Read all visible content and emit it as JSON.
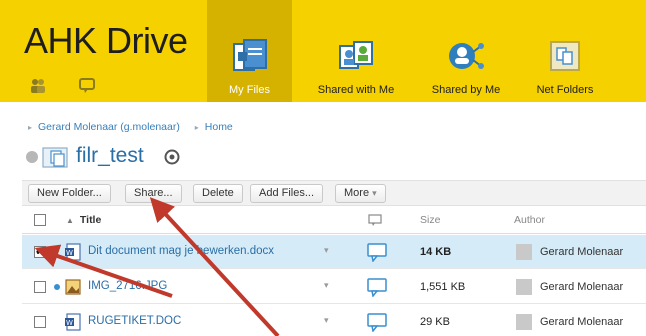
{
  "app": {
    "title": "AHK Drive"
  },
  "colors": {
    "header_bg": "#f6d100",
    "active_tab": "#d6b200",
    "link": "#2a6ea6",
    "selected_row": "#d5ecf8",
    "arrow": "#c0392b"
  },
  "header_icons": [
    {
      "name": "users-icon"
    },
    {
      "name": "chat-icon"
    }
  ],
  "nav": [
    {
      "label": "My Files",
      "icon": "my-files-icon",
      "active": true
    },
    {
      "label": "Shared with Me",
      "icon": "shared-with-me-icon",
      "active": false
    },
    {
      "label": "Shared by Me",
      "icon": "shared-by-me-icon",
      "active": false
    },
    {
      "label": "Net Folders",
      "icon": "net-folders-icon",
      "active": false
    }
  ],
  "breadcrumb": [
    {
      "label": "Gerard Molenaar (g.molenaar)"
    },
    {
      "label": "Home"
    }
  ],
  "folder": {
    "name": "filr_test"
  },
  "toolbar": {
    "new_folder": "New Folder...",
    "share": "Share...",
    "delete": "Delete",
    "add_files": "Add Files...",
    "more": "More"
  },
  "table": {
    "columns": {
      "title": "Title",
      "size": "Size",
      "author": "Author"
    },
    "rows": [
      {
        "name": "Dit document mag je bewerken.docx",
        "size": "14 KB",
        "author": "Gerard Molenaar",
        "checked": true,
        "selected": true,
        "type": "docx"
      },
      {
        "name": "IMG_2716.JPG",
        "size": "1,551 KB",
        "author": "Gerard Molenaar",
        "checked": false,
        "selected": false,
        "type": "jpg",
        "new": true
      },
      {
        "name": "RUGETIKET.DOC",
        "size": "29 KB",
        "author": "Gerard Molenaar",
        "checked": false,
        "selected": false,
        "type": "doc"
      }
    ]
  }
}
